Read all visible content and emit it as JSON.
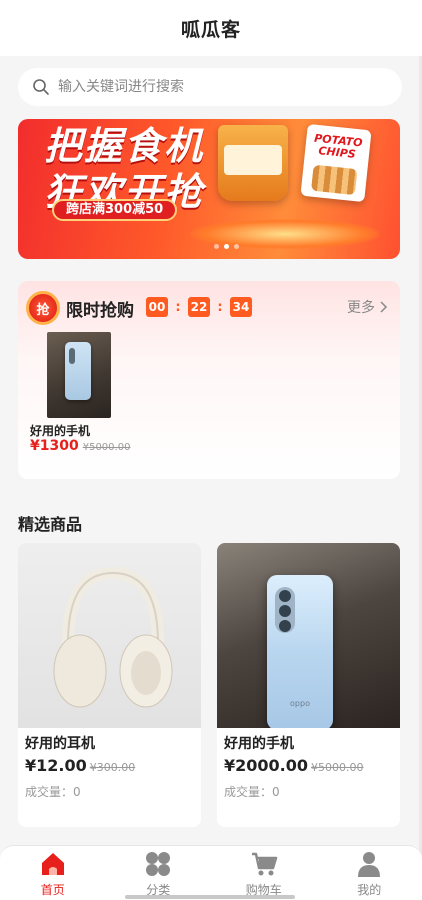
{
  "header": {
    "title": "呱瓜客"
  },
  "search": {
    "placeholder": "输入关键词进行搜索",
    "icon": "search-icon"
  },
  "banner": {
    "line1": "把握食机",
    "line2": "狂欢开抢",
    "promo": "跨店满300减50",
    "chips_brand": "POTATO CHIPS",
    "slides": 3,
    "active_slide": 2
  },
  "flash_sale": {
    "badge": "抢",
    "title": "限时抢购",
    "timer": {
      "hours": "00",
      "minutes": "22",
      "seconds": "34"
    },
    "timer_sep": ":",
    "more": "更多",
    "items": [
      {
        "name": "好用的手机",
        "price": "¥1300",
        "old_price": "¥5000.00"
      }
    ]
  },
  "featured": {
    "title": "精选商品",
    "items": [
      {
        "name": "好用的耳机",
        "price": "¥12.00",
        "old_price": "¥300.00",
        "sales": "成交量：0"
      },
      {
        "name": "好用的手机",
        "price": "¥2000.00",
        "old_price": "¥5000.00",
        "sales": "成交量：0",
        "brand": "oppo"
      }
    ]
  },
  "tabbar": {
    "items": [
      {
        "label": "首页",
        "icon": "home-icon",
        "active": true
      },
      {
        "label": "分类",
        "icon": "category-icon",
        "active": false
      },
      {
        "label": "购物车",
        "icon": "cart-icon",
        "active": false
      },
      {
        "label": "我的",
        "icon": "profile-icon",
        "active": false
      }
    ]
  },
  "colors": {
    "accent": "#e8201b",
    "timer": "#ff5a1f",
    "inactive": "#888888"
  }
}
